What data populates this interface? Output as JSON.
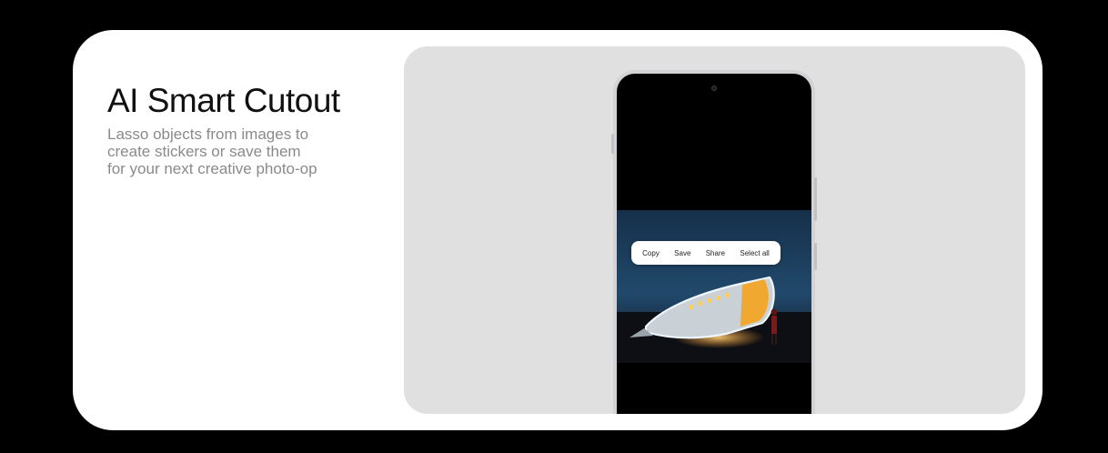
{
  "feature": {
    "title": "AI Smart Cutout",
    "description_lines": [
      "Lasso objects from images to",
      "create stickers or save them",
      "for your next creative photo-op"
    ]
  },
  "context_menu": {
    "items": [
      {
        "label": "Copy"
      },
      {
        "label": "Save"
      },
      {
        "label": "Share"
      },
      {
        "label": "Select all"
      }
    ]
  },
  "colors": {
    "background": "#000000",
    "card": "#ffffff",
    "stage": "#e0e0e0",
    "title": "#111111",
    "subtitle": "#8a8a8a",
    "cutout_glow": "#e8f2ff"
  }
}
